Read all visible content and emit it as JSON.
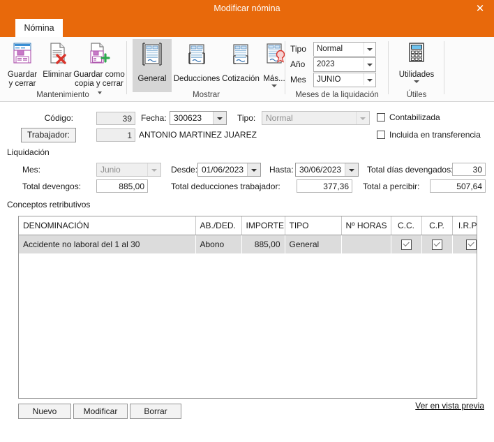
{
  "window": {
    "title": "Modificar nómina",
    "close_icon": "close-icon",
    "accent_color": "#e8690b"
  },
  "tabs": [
    {
      "label": "Nómina",
      "selected": true
    }
  ],
  "ribbon": {
    "groups": [
      {
        "name": "Mantenimiento",
        "label": "Mantenimiento",
        "buttons": [
          {
            "name": "guardar-y-cerrar",
            "label": "Guardar\ny cerrar",
            "line1": "Guardar",
            "line2": "y cerrar",
            "icon": "save-close-icon",
            "dropdown": false
          },
          {
            "name": "eliminar",
            "label": "Eliminar",
            "line1": "Eliminar",
            "line2": "",
            "icon": "delete-document-icon",
            "dropdown": false
          },
          {
            "name": "guardar-como-copia-y-cerrar",
            "label": "Guardar como copia y cerrar",
            "line1": "Guardar como",
            "line2": "copia y cerrar",
            "icon": "save-copy-icon",
            "dropdown": true
          }
        ]
      },
      {
        "name": "Mostrar",
        "label": "Mostrar",
        "buttons": [
          {
            "name": "general",
            "label": "General",
            "line1": "General",
            "line2": "",
            "icon": "page-general-icon",
            "selected": true
          },
          {
            "name": "deducciones",
            "label": "Deducciones",
            "line1": "Deducciones",
            "line2": "",
            "icon": "page-deductions-icon"
          },
          {
            "name": "cotizacion",
            "label": "Cotización",
            "line1": "Cotización",
            "line2": "",
            "icon": "page-quote-icon"
          },
          {
            "name": "mas",
            "label": "Más...",
            "line1": "Más...",
            "line2": "",
            "icon": "page-more-seal-icon",
            "dropdown": true
          }
        ]
      },
      {
        "name": "MesesLiquidacion",
        "label": "Meses de la liquidación",
        "fields": [
          {
            "name": "tipo",
            "label": "Tipo",
            "value": "Normal"
          },
          {
            "name": "ano",
            "label": "Año",
            "value": "2023"
          },
          {
            "name": "mes",
            "label": "Mes",
            "value": "JUNIO"
          }
        ]
      },
      {
        "name": "Utiles",
        "label": "Útiles",
        "buttons": [
          {
            "name": "utilidades",
            "label": "Utilidades",
            "line1": "Utilidades",
            "line2": "",
            "icon": "calculator-icon",
            "dropdown": true
          }
        ]
      }
    ]
  },
  "form": {
    "codigo_label": "Código:",
    "codigo_value": "39",
    "fecha_label": "Fecha:",
    "fecha_value": "300623",
    "tipo_label": "Tipo:",
    "tipo_value": "Normal",
    "trabajador_button": "Trabajador:",
    "trabajador_code": "1",
    "trabajador_name": "ANTONIO MARTINEZ JUAREZ",
    "contabilizada_label": "Contabilizada",
    "contabilizada_checked": false,
    "transferencia_label": "Incluida en transferencia",
    "transferencia_checked": false,
    "liquidacion_title": "Liquidación",
    "mes_label": "Mes:",
    "mes_value": "Junio",
    "desde_label": "Desde:",
    "desde_value": "01/06/2023",
    "hasta_label": "Hasta:",
    "hasta_value": "30/06/2023",
    "total_dias_label": "Total días devengados:",
    "total_dias_value": "30",
    "total_devengos_label": "Total devengos:",
    "total_devengos_value": "885,00",
    "total_deducciones_label": "Total deducciones trabajador:",
    "total_deducciones_value": "377,36",
    "total_percibir_label": "Total a percibir:",
    "total_percibir_value": "507,64"
  },
  "grid": {
    "title": "Conceptos retributivos",
    "columns": [
      "DENOMINACIÓN",
      "AB./DED.",
      "IMPORTE",
      "TIPO",
      "Nº HORAS",
      "C.C.",
      "C.P.",
      "I.R.P.F."
    ],
    "rows": [
      {
        "denominacion": "Accidente no laboral del 1 al 30",
        "abded": "Abono",
        "importe": "885,00",
        "tipo": "General",
        "horas": "",
        "cc": true,
        "cp": true,
        "irpf": true,
        "selected": true
      }
    ]
  },
  "footer": {
    "buttons": [
      {
        "name": "nuevo",
        "label": "Nuevo"
      },
      {
        "name": "modificar",
        "label": "Modificar"
      },
      {
        "name": "borrar",
        "label": "Borrar"
      }
    ],
    "preview_link": "Ver en vista previa"
  }
}
